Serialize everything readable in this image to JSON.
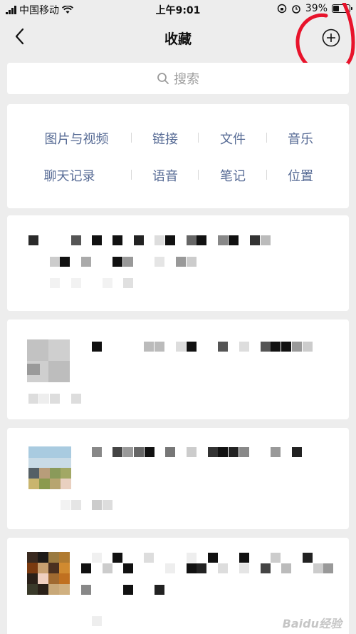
{
  "status_bar": {
    "carrier": "中国移动",
    "time": "上午9:01",
    "battery": "39%"
  },
  "header": {
    "title": "收藏",
    "back_icon": "back-arrow-icon",
    "add_icon": "plus-circle-icon"
  },
  "search": {
    "placeholder": "搜索"
  },
  "categories": {
    "row1": [
      "图片与视频",
      "链接",
      "文件",
      "音乐"
    ],
    "row2": [
      "聊天记录",
      "语音",
      "笔记",
      "位置"
    ]
  },
  "colors": {
    "accent_link": "#576b95",
    "annotation": "#e8132b",
    "background": "#ededed"
  },
  "favorites": [
    {
      "content": "pixelated",
      "has_thumbnail": false
    },
    {
      "content": "pixelated",
      "has_thumbnail": true
    },
    {
      "content": "pixelated",
      "has_thumbnail": true
    },
    {
      "content": "pixelated",
      "has_thumbnail": true
    }
  ],
  "watermark": "Baidu经验"
}
